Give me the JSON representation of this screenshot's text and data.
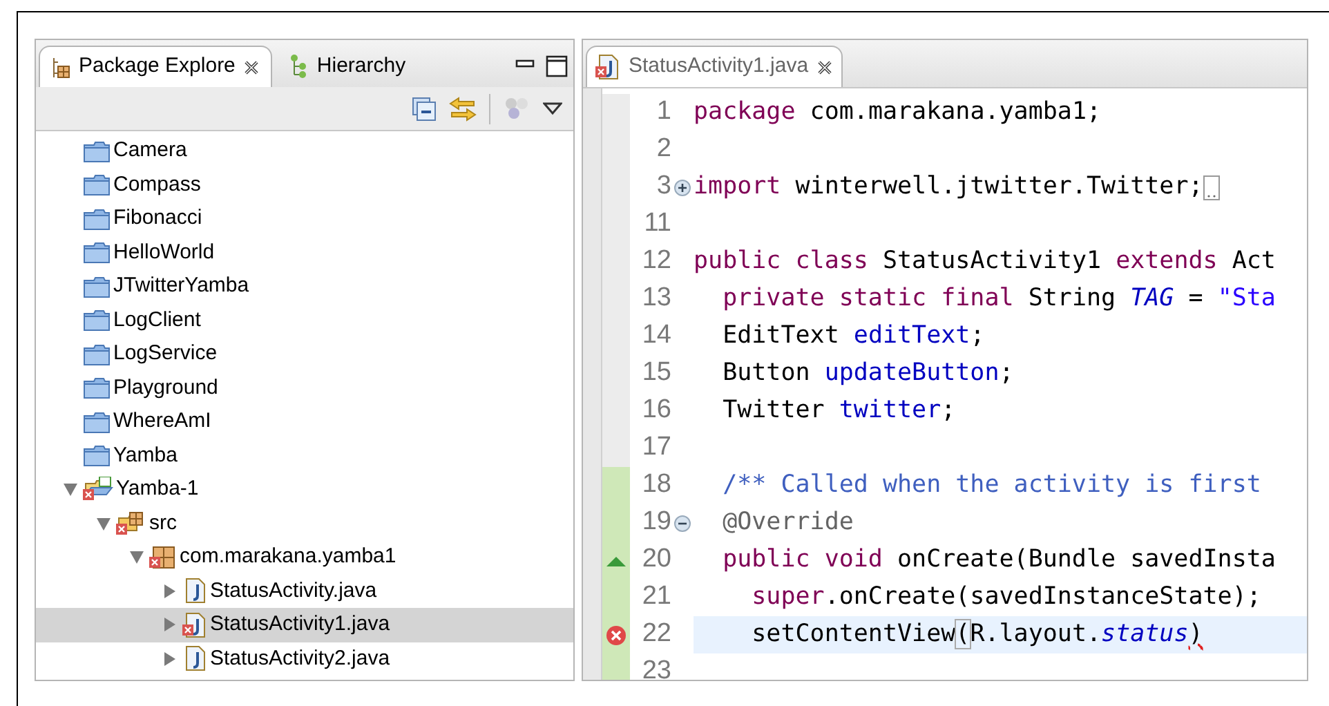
{
  "explorer": {
    "tabs": [
      {
        "label": "Package Explore",
        "selected": true
      },
      {
        "label": "Hierarchy",
        "selected": false
      }
    ],
    "tree": [
      {
        "label": "Camera",
        "kind": "project"
      },
      {
        "label": "Compass",
        "kind": "project"
      },
      {
        "label": "Fibonacci",
        "kind": "project"
      },
      {
        "label": "HelloWorld",
        "kind": "project"
      },
      {
        "label": "JTwitterYamba",
        "kind": "project"
      },
      {
        "label": "LogClient",
        "kind": "project"
      },
      {
        "label": "LogService",
        "kind": "project"
      },
      {
        "label": "Playground",
        "kind": "project"
      },
      {
        "label": "WhereAmI",
        "kind": "project"
      },
      {
        "label": "Yamba",
        "kind": "project"
      },
      {
        "label": "Yamba-1",
        "kind": "open-project",
        "expanded": true,
        "error": true,
        "children": [
          {
            "label": "src",
            "kind": "source",
            "expanded": true,
            "error": true,
            "children": [
              {
                "label": "com.marakana.yamba1",
                "kind": "package",
                "expanded": true,
                "error": true,
                "children": [
                  {
                    "label": "StatusActivity.java",
                    "kind": "java",
                    "expanded": false,
                    "error": false,
                    "selected": false
                  },
                  {
                    "label": "StatusActivity1.java",
                    "kind": "java",
                    "expanded": false,
                    "error": true,
                    "selected": true
                  },
                  {
                    "label": "StatusActivity2.java",
                    "kind": "java",
                    "expanded": false,
                    "error": false,
                    "selected": false
                  }
                ]
              }
            ]
          }
        ]
      }
    ]
  },
  "editor": {
    "tab": {
      "label": "StatusActivity1.java",
      "error": true
    },
    "lines": [
      {
        "number": "1",
        "changed": false,
        "tokens": [
          {
            "text": "package",
            "kind": "keyword"
          },
          {
            "text": " com.marakana.yamba1;",
            "kind": "plain"
          }
        ]
      },
      {
        "number": "2",
        "changed": false
      },
      {
        "number": "3",
        "changed": false,
        "collapsed": true,
        "tokens": [
          {
            "text": "import",
            "kind": "keyword"
          },
          {
            "text": " winterwell.jtwitter.Twitter;",
            "kind": "plain"
          }
        ]
      },
      {
        "number": "11",
        "changed": false
      },
      {
        "number": "12",
        "changed": false,
        "tokens": [
          {
            "text": "public class",
            "kind": "keyword"
          },
          {
            "text": " StatusActivity1 ",
            "kind": "plain"
          },
          {
            "text": "extends",
            "kind": "keyword"
          },
          {
            "text": " Act",
            "kind": "plain"
          }
        ]
      },
      {
        "number": "13",
        "changed": false,
        "tokens": [
          {
            "text": "  private static final",
            "kind": "keyword"
          },
          {
            "text": " String ",
            "kind": "plain"
          },
          {
            "text": "TAG",
            "kind": "static-field"
          },
          {
            "text": " = ",
            "kind": "plain"
          },
          {
            "text": "\"Sta",
            "kind": "string"
          }
        ]
      },
      {
        "number": "14",
        "changed": false,
        "tokens": [
          {
            "text": "  EditText ",
            "kind": "plain"
          },
          {
            "text": "editText",
            "kind": "field"
          },
          {
            "text": ";",
            "kind": "plain"
          }
        ]
      },
      {
        "number": "15",
        "changed": false,
        "tokens": [
          {
            "text": "  Button ",
            "kind": "plain"
          },
          {
            "text": "updateButton",
            "kind": "field"
          },
          {
            "text": ";",
            "kind": "plain"
          }
        ]
      },
      {
        "number": "16",
        "changed": false,
        "tokens": [
          {
            "text": "  Twitter ",
            "kind": "plain"
          },
          {
            "text": "twitter",
            "kind": "field"
          },
          {
            "text": ";",
            "kind": "plain"
          }
        ]
      },
      {
        "number": "17",
        "changed": false
      },
      {
        "number": "18",
        "changed": true,
        "tokens": [
          {
            "text": "  /** Called when the activity is first",
            "kind": "comment"
          }
        ]
      },
      {
        "number": "19",
        "changed": true,
        "collapsed": false,
        "tokens": [
          {
            "text": "  @Override",
            "kind": "annotation"
          }
        ]
      },
      {
        "number": "20",
        "changed": true,
        "override": true,
        "tokens": [
          {
            "text": "  public void",
            "kind": "keyword"
          },
          {
            "text": " onCreate(Bundle savedInsta",
            "kind": "plain"
          }
        ]
      },
      {
        "number": "21",
        "changed": true,
        "tokens": [
          {
            "text": "    super",
            "kind": "keyword"
          },
          {
            "text": ".onCreate(savedInstanceState);",
            "kind": "plain"
          }
        ]
      },
      {
        "number": "22",
        "changed": true,
        "error": true,
        "current": true,
        "tokens": [
          {
            "text": "    setContentView",
            "kind": "plain"
          },
          {
            "text": "(",
            "kind": "bracket-match"
          },
          {
            "text": "R.layout.",
            "kind": "plain"
          },
          {
            "text": "status",
            "kind": "static-field"
          },
          {
            "text": ")",
            "kind": "error"
          }
        ]
      },
      {
        "number": "23",
        "changed": true
      }
    ]
  }
}
